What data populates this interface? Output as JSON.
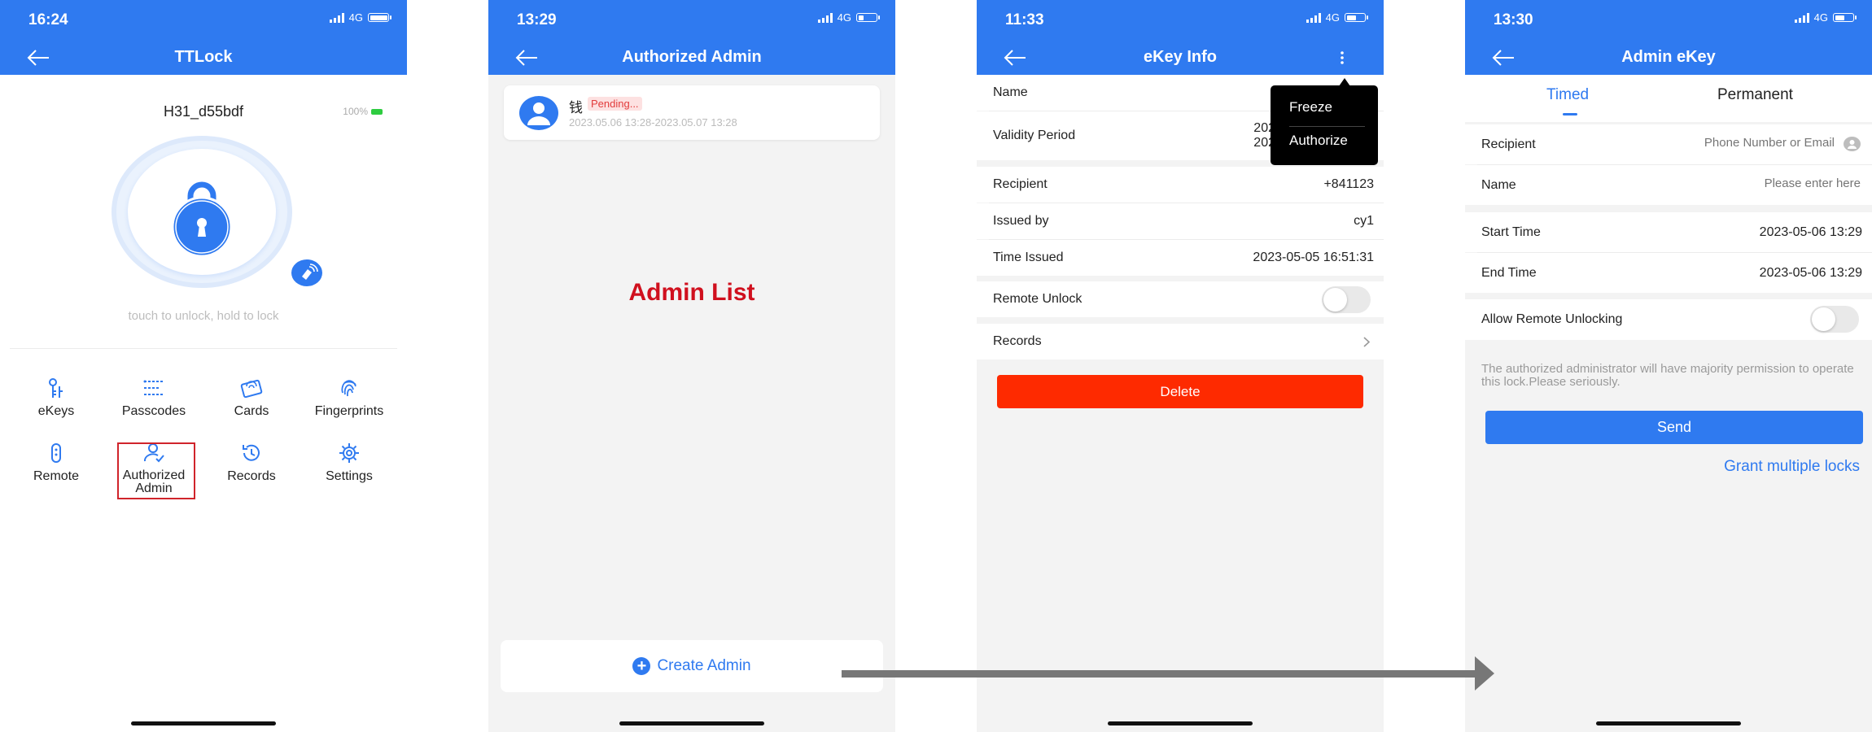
{
  "colors": {
    "accent": "#2f7af0",
    "delete": "#fe2a00",
    "highlight": "#d0242b",
    "annotation": "#d0101e",
    "arrow": "#777777"
  },
  "screen1": {
    "status": {
      "time": "16:24",
      "network": "4G"
    },
    "nav": {
      "title": "TTLock"
    },
    "lock_name": "H31_d55bdf",
    "battery": "100%",
    "hint": "touch to unlock, hold to lock",
    "menu": [
      {
        "label": "eKeys",
        "icon": "ekey-icon"
      },
      {
        "label": "Passcodes",
        "icon": "passcode-icon"
      },
      {
        "label": "Cards",
        "icon": "card-icon"
      },
      {
        "label": "Fingerprints",
        "icon": "fingerprint-icon"
      },
      {
        "label": "Remote",
        "icon": "remote-icon"
      },
      {
        "label": "Authorized Admin",
        "icon": "admin-icon"
      },
      {
        "label": "Records",
        "icon": "history-icon"
      },
      {
        "label": "Settings",
        "icon": "gear-icon"
      }
    ]
  },
  "screen2": {
    "status": {
      "time": "13:29",
      "network": "4G"
    },
    "nav": {
      "title": "Authorized Admin"
    },
    "admin": {
      "name": "钱",
      "status": "Pending...",
      "period": "2023.05.06 13:28-2023.05.07 13:28"
    },
    "annotation": "Admin List",
    "create_button": "Create Admin"
  },
  "screen3": {
    "status": {
      "time": "11:33",
      "network": "4G"
    },
    "nav": {
      "title": "eKey Info"
    },
    "rows": {
      "name_label": "Name",
      "validity_label": "Validity Period",
      "validity_value_1": "202",
      "validity_value_2": "202",
      "recipient_label": "Recipient",
      "recipient_value": "+841123",
      "issued_by_label": "Issued by",
      "issued_by_value": "cy1",
      "time_issued_label": "Time Issued",
      "time_issued_value": "2023-05-05 16:51:31",
      "remote_unlock_label": "Remote Unlock",
      "records_label": "Records"
    },
    "delete_button": "Delete",
    "popup": {
      "freeze": "Freeze",
      "authorize": "Authorize"
    }
  },
  "screen4": {
    "status": {
      "time": "13:30",
      "network": "4G"
    },
    "nav": {
      "title": "Admin eKey"
    },
    "tabs": {
      "timed": "Timed",
      "permanent": "Permanent",
      "active": "Timed"
    },
    "recipient_label": "Recipient",
    "recipient_placeholder": "Phone Number or Email",
    "name_label": "Name",
    "name_placeholder": "Please enter here",
    "start_label": "Start Time",
    "start_value": "2023-05-06 13:29",
    "end_label": "End Time",
    "end_value": "2023-05-06 13:29",
    "remote_label": "Allow Remote Unlocking",
    "note": "The authorized administrator will have majority permission to operate this lock.Please seriously.",
    "send_button": "Send",
    "grant_link": "Grant multiple locks"
  }
}
